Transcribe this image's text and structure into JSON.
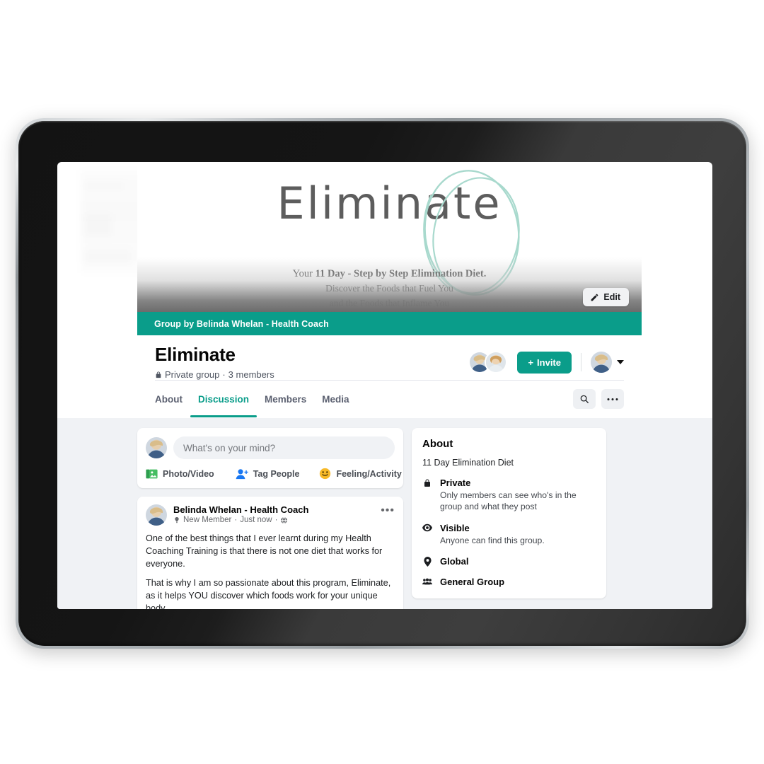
{
  "cover": {
    "logo_text": "Eliminate",
    "subtitle_line1_prefix": "Your ",
    "subtitle_line1_bold": "11 Day - Step by Step Elimination Diet.",
    "subtitle_line2": "Discover the Foods that Fuel You",
    "subtitle_line3": "and the Foods that Inflame You",
    "banner_text": "Group by Belinda Whelan - Health Coach",
    "edit_label": "Edit",
    "banner_color": "#0a9d8a"
  },
  "group": {
    "name": "Eliminate",
    "privacy": "Private group",
    "members": "3 members",
    "meta_separator": "·",
    "invite_label": "Invite",
    "invite_plus": "+"
  },
  "tabs": [
    {
      "label": "About",
      "active": false
    },
    {
      "label": "Discussion",
      "active": true
    },
    {
      "label": "Members",
      "active": false
    },
    {
      "label": "Media",
      "active": false
    }
  ],
  "composer": {
    "placeholder": "What's on your mind?",
    "value": "",
    "actions": [
      {
        "label": "Photo/Video",
        "icon": "photo-video-icon"
      },
      {
        "label": "Tag People",
        "icon": "tag-people-icon"
      },
      {
        "label": "Feeling/Activity",
        "icon": "feeling-activity-icon"
      }
    ]
  },
  "post": {
    "author": "Belinda Whelan - Health Coach",
    "badge": "New Member",
    "time": "Just now",
    "sep": "·",
    "paragraphs": [
      "One of the best things that I ever learnt during my Health Coaching Training is that there is not one diet that works for everyone.",
      "That is why I am so passionate about this program, Eliminate, as it helps YOU discover which foods work for your unique body.\nAre you excited to learn what fuels you?"
    ],
    "menu_glyph": "•••"
  },
  "about": {
    "title": "About",
    "description": "11 Day Elimination Diet",
    "rows": [
      {
        "icon": "lock-icon",
        "title": "Private",
        "desc": "Only members can see who's in the group and what they post"
      },
      {
        "icon": "eye-icon",
        "title": "Visible",
        "desc": "Anyone can find this group."
      },
      {
        "icon": "location-pin-icon",
        "title": "Global",
        "desc": ""
      },
      {
        "icon": "group-people-icon",
        "title": "General Group",
        "desc": ""
      }
    ]
  },
  "colors": {
    "accent": "#0a9d8a",
    "page_bg": "#f0f2f5",
    "text_primary": "#050505",
    "text_secondary": "#65676b"
  }
}
